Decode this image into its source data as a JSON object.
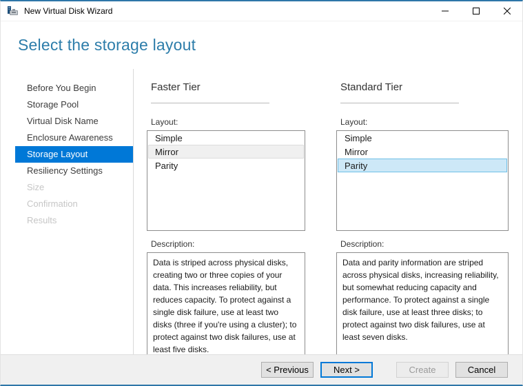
{
  "window": {
    "title": "New Virtual Disk Wizard",
    "controls": {
      "minimize": "minimize",
      "maximize": "maximize",
      "close": "close"
    }
  },
  "page": {
    "title": "Select the storage layout"
  },
  "sidebar": {
    "items": [
      {
        "label": "Before You Begin",
        "state": "enabled"
      },
      {
        "label": "Storage Pool",
        "state": "enabled"
      },
      {
        "label": "Virtual Disk Name",
        "state": "enabled"
      },
      {
        "label": "Enclosure Awareness",
        "state": "enabled"
      },
      {
        "label": "Storage Layout",
        "state": "selected"
      },
      {
        "label": "Resiliency Settings",
        "state": "enabled"
      },
      {
        "label": "Size",
        "state": "disabled"
      },
      {
        "label": "Confirmation",
        "state": "disabled"
      },
      {
        "label": "Results",
        "state": "disabled"
      }
    ]
  },
  "tiers": [
    {
      "name": "Faster Tier",
      "layout_label": "Layout:",
      "options": [
        "Simple",
        "Mirror",
        "Parity"
      ],
      "selected_option": "Mirror",
      "selection_style": "inactive",
      "description_label": "Description:",
      "description": "Data is striped across physical disks, creating two or three copies of your data. This increases reliability, but reduces capacity. To protect against a single disk failure, use at least two disks (three if you're using a cluster); to protect against two disk failures, use at least five disks."
    },
    {
      "name": "Standard Tier",
      "layout_label": "Layout:",
      "options": [
        "Simple",
        "Mirror",
        "Parity"
      ],
      "selected_option": "Parity",
      "selection_style": "active",
      "description_label": "Description:",
      "description": "Data and parity information are striped across physical disks, increasing reliability, but somewhat reducing capacity and performance. To protect against a single disk failure, use at least three disks; to protect against two disk failures, use at least seven disks."
    }
  ],
  "footer": {
    "buttons": [
      {
        "label": "< Previous",
        "state": "enabled"
      },
      {
        "label": "Next >",
        "state": "focused"
      },
      {
        "label": "Create",
        "state": "disabled"
      },
      {
        "label": "Cancel",
        "state": "enabled"
      }
    ]
  },
  "colors": {
    "accent": "#0078d7",
    "window_border": "#2e76a8",
    "header_text": "#2d7daa",
    "sidebar_selected_bg": "#0078d7",
    "selection_active_bg": "#cde8f7",
    "selection_active_border": "#70c0e7",
    "selection_inactive_bg": "#f0f0f0",
    "selection_inactive_border": "#dcdcdc",
    "footer_bg": "#f0f0f0"
  }
}
